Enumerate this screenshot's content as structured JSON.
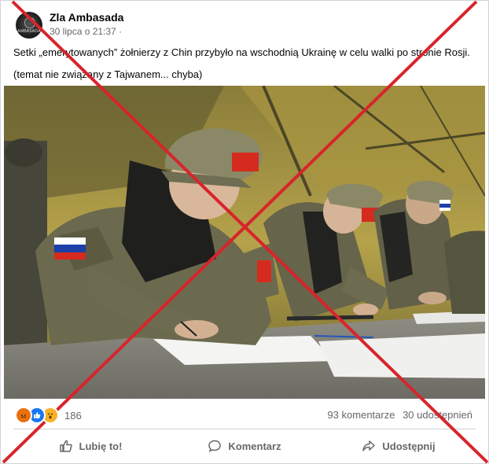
{
  "post": {
    "page_name": "Zla Ambasada",
    "avatar_text": "AMBASADA",
    "timestamp": "30 lipca o 21:37 ·",
    "text_line1": "Setki „emerytowanych” żołnierzy z Chin przybyło na wschodnią Ukrainę w celu walki po stronie Rosji.",
    "text_line2": "(temat nie związany z Tajwanem... chyba)"
  },
  "reactions": {
    "icons": [
      "angry-icon",
      "like-icon",
      "wow-icon"
    ],
    "count": "186"
  },
  "stats": {
    "comments": "93 komentarze",
    "shares": "30 udostępnień"
  },
  "actions": {
    "like": "Lubię to!",
    "comment": "Komentarz",
    "share": "Udostępnij"
  },
  "colors": {
    "cross": "#d8242b",
    "like_blue": "#1877f2",
    "meta_gray": "#65676b"
  }
}
